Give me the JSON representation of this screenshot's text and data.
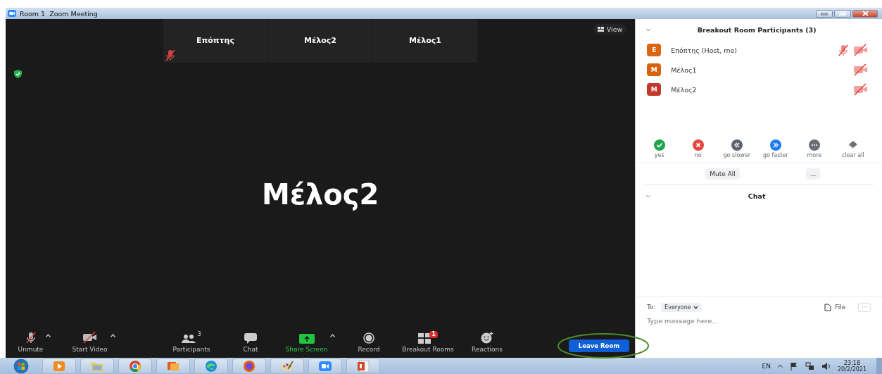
{
  "window": {
    "title": "Room 1  Zoom Meeting"
  },
  "video": {
    "encrypted": true,
    "view_button": "View",
    "speaker": "Μέλος2",
    "tiles": [
      {
        "name": "Επόπτης",
        "muted": true
      },
      {
        "name": "Μέλος2",
        "muted": false
      },
      {
        "name": "Μέλος1",
        "muted": false
      }
    ]
  },
  "toolbar": {
    "items": [
      {
        "kind": "mic",
        "label": "Unmute",
        "off": true,
        "caret": true
      },
      {
        "kind": "video",
        "label": "Start Video",
        "off": true,
        "caret": true
      },
      {
        "kind": "participants",
        "label": "Participants",
        "count": "3",
        "caret": false
      },
      {
        "kind": "chat",
        "label": "Chat",
        "caret": false
      },
      {
        "kind": "share",
        "label": "Share Screen",
        "caret": true
      },
      {
        "kind": "record",
        "label": "Record",
        "caret": false
      },
      {
        "kind": "breakout",
        "label": "Breakout Rooms",
        "count": "1",
        "caret": false
      },
      {
        "kind": "reactions",
        "label": "Reactions",
        "caret": false
      }
    ],
    "leave_button": "Leave Room"
  },
  "panel": {
    "participants_header": "Breakout Room Participants (3)",
    "participants": [
      {
        "initial": "Ε",
        "name": "Επόπτης (Host, me)",
        "color": "#dd6410",
        "muted": true,
        "video_off": true
      },
      {
        "initial": "Μ",
        "name": "Μέλος1",
        "color": "#d9620f",
        "muted": false,
        "video_off": true
      },
      {
        "initial": "Μ",
        "name": "Μέλος2",
        "color": "#c0392b",
        "muted": false,
        "video_off": true
      }
    ],
    "reactions": [
      {
        "kind": "yes",
        "label": "yes"
      },
      {
        "kind": "no",
        "label": "no"
      },
      {
        "kind": "slower",
        "label": "go slower"
      },
      {
        "kind": "faster",
        "label": "go faster"
      },
      {
        "kind": "more",
        "label": "more"
      },
      {
        "kind": "clear",
        "label": "clear all"
      }
    ],
    "mute_all": "Mute All",
    "more_button": "...",
    "chat_header": "Chat",
    "chat": {
      "to_label": "To:",
      "recipient": "Everyone",
      "file_button": "File",
      "more_button": "···",
      "placeholder": "Type message here..."
    }
  },
  "taskbar": {
    "apps": [
      {
        "kind": "media"
      },
      {
        "kind": "folder"
      },
      {
        "kind": "chrome"
      },
      {
        "kind": "photos"
      },
      {
        "kind": "edge"
      },
      {
        "kind": "firefox"
      },
      {
        "kind": "paint"
      },
      {
        "kind": "zoom"
      },
      {
        "kind": "slides"
      }
    ],
    "language": "EN",
    "time": "23:18",
    "date": "20/2/2021"
  }
}
